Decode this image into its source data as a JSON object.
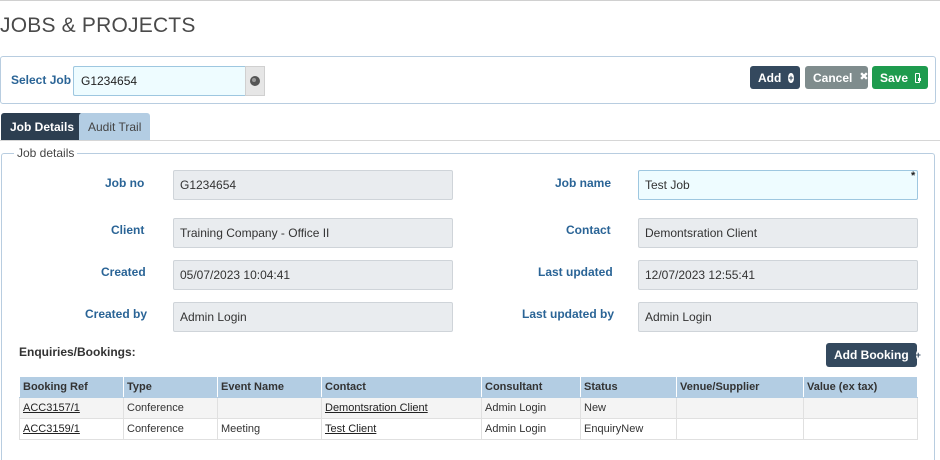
{
  "page": {
    "title": "JOBS & PROJECTS"
  },
  "select_job": {
    "label": "Select Job",
    "value": "G1234654",
    "lookup_icon": "globe-icon"
  },
  "toolbar": {
    "add_label": "Add",
    "cancel_label": "Cancel",
    "save_label": "Save",
    "colors": {
      "add": "#34495e",
      "cancel": "#7f8c8d",
      "save": "#1e9b4e"
    }
  },
  "tabs": [
    {
      "label": "Job Details",
      "active": true
    },
    {
      "label": "Audit Trail",
      "active": false
    }
  ],
  "job_details": {
    "legend": "Job details",
    "required_marker": "*",
    "fields": {
      "job_no": {
        "label": "Job no",
        "value": "G1234654"
      },
      "job_name": {
        "label": "Job name",
        "value": "Test Job"
      },
      "client": {
        "label": "Client",
        "value": "Training Company - Office II"
      },
      "contact": {
        "label": "Contact",
        "value": "Demontsration Client"
      },
      "created": {
        "label": "Created",
        "value": "05/07/2023 10:04:41"
      },
      "last_updated": {
        "label": "Last updated",
        "value": "12/07/2023 12:55:41"
      },
      "created_by": {
        "label": "Created by",
        "value": "Admin Login"
      },
      "last_updated_by": {
        "label": "Last updated by",
        "value": "Admin Login"
      }
    }
  },
  "enquiries": {
    "title": "Enquiries/Bookings:",
    "add_booking_label": "Add Booking",
    "columns": [
      "Booking Ref",
      "Type",
      "Event Name",
      "Contact",
      "Consultant",
      "Status",
      "Venue/Supplier",
      "Value (ex tax)"
    ],
    "rows": [
      [
        "ACC3157/1",
        "Conference",
        "",
        "Demontsration Client",
        "Admin Login",
        "New",
        "",
        ""
      ],
      [
        "ACC3159/1",
        "Conference",
        "Meeting",
        "Test Client",
        "Admin Login",
        "EnquiryNew",
        "",
        ""
      ]
    ]
  }
}
